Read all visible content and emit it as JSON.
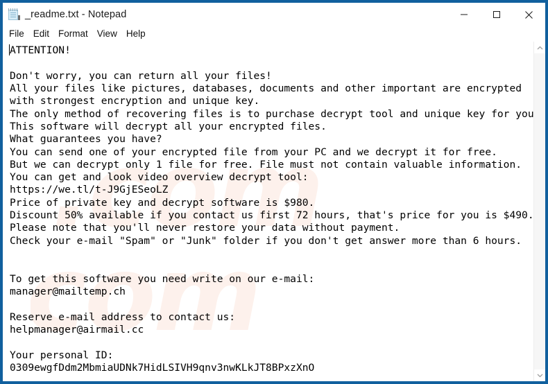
{
  "window": {
    "title": "_readme.txt - Notepad",
    "icon": "notepad-icon",
    "border_color": "#11609e",
    "background_color": "#ffffff"
  },
  "window_controls": {
    "minimize": {
      "label": "Minimize",
      "icon": "minimize-icon"
    },
    "maximize": {
      "label": "Maximize",
      "icon": "maximize-icon"
    },
    "close": {
      "label": "Close",
      "icon": "close-icon"
    }
  },
  "menu_bar": {
    "items": [
      {
        "label": "File"
      },
      {
        "label": "Edit"
      },
      {
        "label": "Format"
      },
      {
        "label": "View"
      },
      {
        "label": "Help"
      }
    ]
  },
  "editor": {
    "caret_visible": true,
    "text": "ATTENTION!\n\nDon't worry, you can return all your files!\nAll your files like pictures, databases, documents and other important are encrypted\nwith strongest encryption and unique key.\nThe only method of recovering files is to purchase decrypt tool and unique key for you.\nThis software will decrypt all your encrypted files.\nWhat guarantees you have?\nYou can send one of your encrypted file from your PC and we decrypt it for free.\nBut we can decrypt only 1 file for free. File must not contain valuable information.\nYou can get and look video overview decrypt tool:\nhttps://we.tl/t-J9GjESeoLZ\nPrice of private key and decrypt software is $980.\nDiscount 50% available if you contact us first 72 hours, that's price for you is $490.\nPlease note that you'll never restore your data without payment.\nCheck your e-mail \"Spam\" or \"Junk\" folder if you don't get answer more than 6 hours.\n\n\nTo get this software you need write on our e-mail:\nmanager@mailtemp.ch\n\nReserve e-mail address to contact us:\nhelpmanager@airmail.cc\n\nYour personal ID:\n0309ewgfDdm2MbmiaUDNk7HidLSIVH9qnv3nwKLkJT8BPxzXnO",
    "lines": [
      "ATTENTION!",
      "",
      "Don't worry, you can return all your files!",
      "All your files like pictures, databases, documents and other important are encrypted",
      "with strongest encryption and unique key.",
      "The only method of recovering files is to purchase decrypt tool and unique key for you.",
      "This software will decrypt all your encrypted files.",
      "What guarantees you have?",
      "You can send one of your encrypted file from your PC and we decrypt it for free.",
      "But we can decrypt only 1 file for free. File must not contain valuable information.",
      "You can get and look video overview decrypt tool:",
      "https://we.tl/t-J9GjESeoLZ",
      "Price of private key and decrypt software is $980.",
      "Discount 50% available if you contact us first 72 hours, that's price for you is $490.",
      "Please note that you'll never restore your data without payment.",
      "Check your e-mail \"Spam\" or \"Junk\" folder if you don't get answer more than 6 hours.",
      "",
      "",
      "To get this software you need write on our e-mail:",
      "manager@mailtemp.ch",
      "",
      "Reserve e-mail address to contact us:",
      "helpmanager@airmail.cc",
      "",
      "Your personal ID:",
      "0309ewgfDdm2MbmiaUDNk7HidLSIVH9qnv3nwKLkJT8BPxzXnO"
    ],
    "key_values": {
      "video_url": "https://we.tl/t-J9GjESeoLZ",
      "full_price": "$980",
      "discount_percent": "50%",
      "discount_window": "72 hours",
      "discount_price": "$490",
      "response_time": "6 hours",
      "free_decrypt_files": "1",
      "primary_email": "manager@mailtemp.ch",
      "reserve_email": "helpmanager@airmail.cc",
      "personal_id": "0309ewgfDdm2MbmiaUDNk7HidLSIVH9qnv3nwKLkJT8BPxzXnO"
    }
  },
  "watermark": {
    "line1": ".com",
    "line2": ".com",
    "color": "#fdf1ec"
  },
  "scrollbar": {
    "up_arrow": "chevron-up-icon",
    "down_arrow": "chevron-down-icon",
    "thumb_visible": false
  }
}
